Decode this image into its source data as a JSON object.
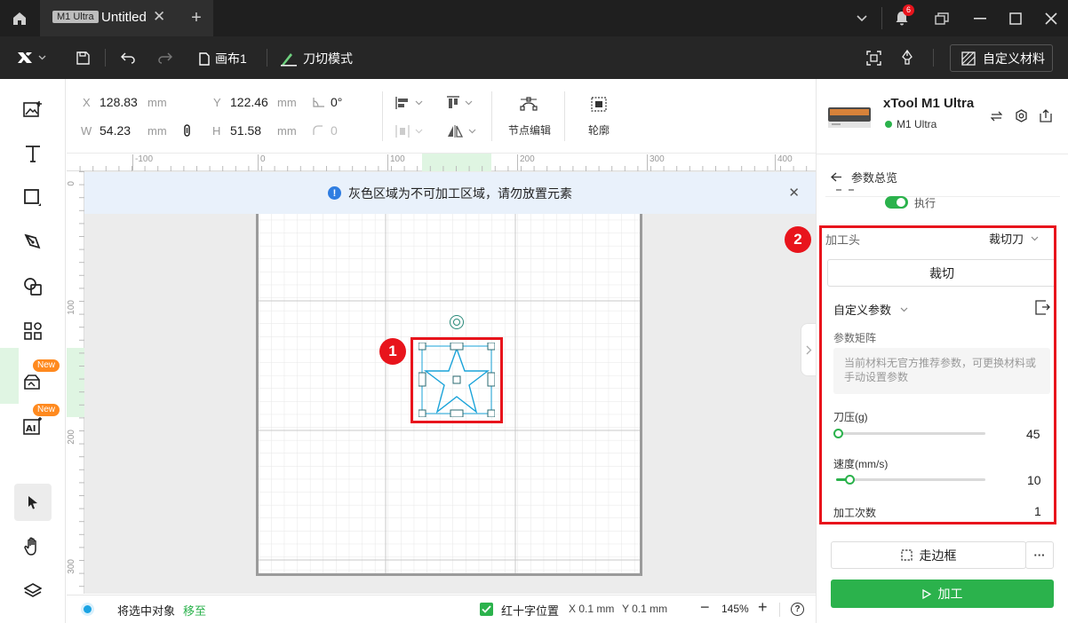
{
  "titlebar": {
    "badge": "M1 Ultra",
    "tab_title": "Untitled",
    "notification_count": "6"
  },
  "toolbar": {
    "canvas_label": "画布1",
    "mode_label": "刀切模式",
    "custom_material_label": "自定义材料"
  },
  "left": {
    "new_badge_1": "New",
    "new_badge_2": "New"
  },
  "props": {
    "x_label": "X",
    "x_value": "128.83",
    "x_unit": "mm",
    "y_label": "Y",
    "y_value": "122.46",
    "y_unit": "mm",
    "w_label": "W",
    "w_value": "54.23",
    "w_unit": "mm",
    "h_label": "H",
    "h_value": "51.58",
    "h_unit": "mm",
    "angle_value": "0°",
    "radius_value": "0",
    "node_edit_label": "节点编辑",
    "outline_label": "轮廓"
  },
  "ruler": {
    "h_ticks": [
      "-100",
      "0",
      "100",
      "200",
      "300",
      "400"
    ],
    "v_ticks": [
      "0",
      "100",
      "200",
      "300"
    ]
  },
  "notice": {
    "text": "灰色区域为不可加工区域，请勿放置元素"
  },
  "annotations": {
    "marker_1": "1",
    "marker_2": "2"
  },
  "status": {
    "move_text": "将选中对象",
    "move_link": "移至",
    "crosshair_label": "红十字位置",
    "x_coord": "X 0.1 mm",
    "y_coord": "Y 0.1 mm",
    "zoom": "145%"
  },
  "device": {
    "name": "xTool M1 Ultra",
    "status_label": "M1 Ultra"
  },
  "panel": {
    "back_title": "参数总览",
    "execute_label": "执行",
    "head_label": "加工头",
    "head_value": "裁切刀",
    "cut_button": "裁切",
    "custom_params": "自定义参数",
    "matrix_label": "参数矩阵",
    "matrix_note": "当前材料无官方推荐参数，可更换材料或手动设置参数",
    "pressure_label": "刀压(g)",
    "pressure_value": "45",
    "pressure_fraction": 0.01,
    "speed_label": "速度(mm/s)",
    "speed_value": "10",
    "speed_fraction": 0.09,
    "passes_label": "加工次数",
    "passes_value": "1",
    "frame_button": "走边框",
    "more_button": "···",
    "process_button": "加工"
  },
  "colors": {
    "accent_green": "#2bb24c",
    "annotation_red": "#e8141c",
    "selection_blue": "#1aa3d9"
  }
}
